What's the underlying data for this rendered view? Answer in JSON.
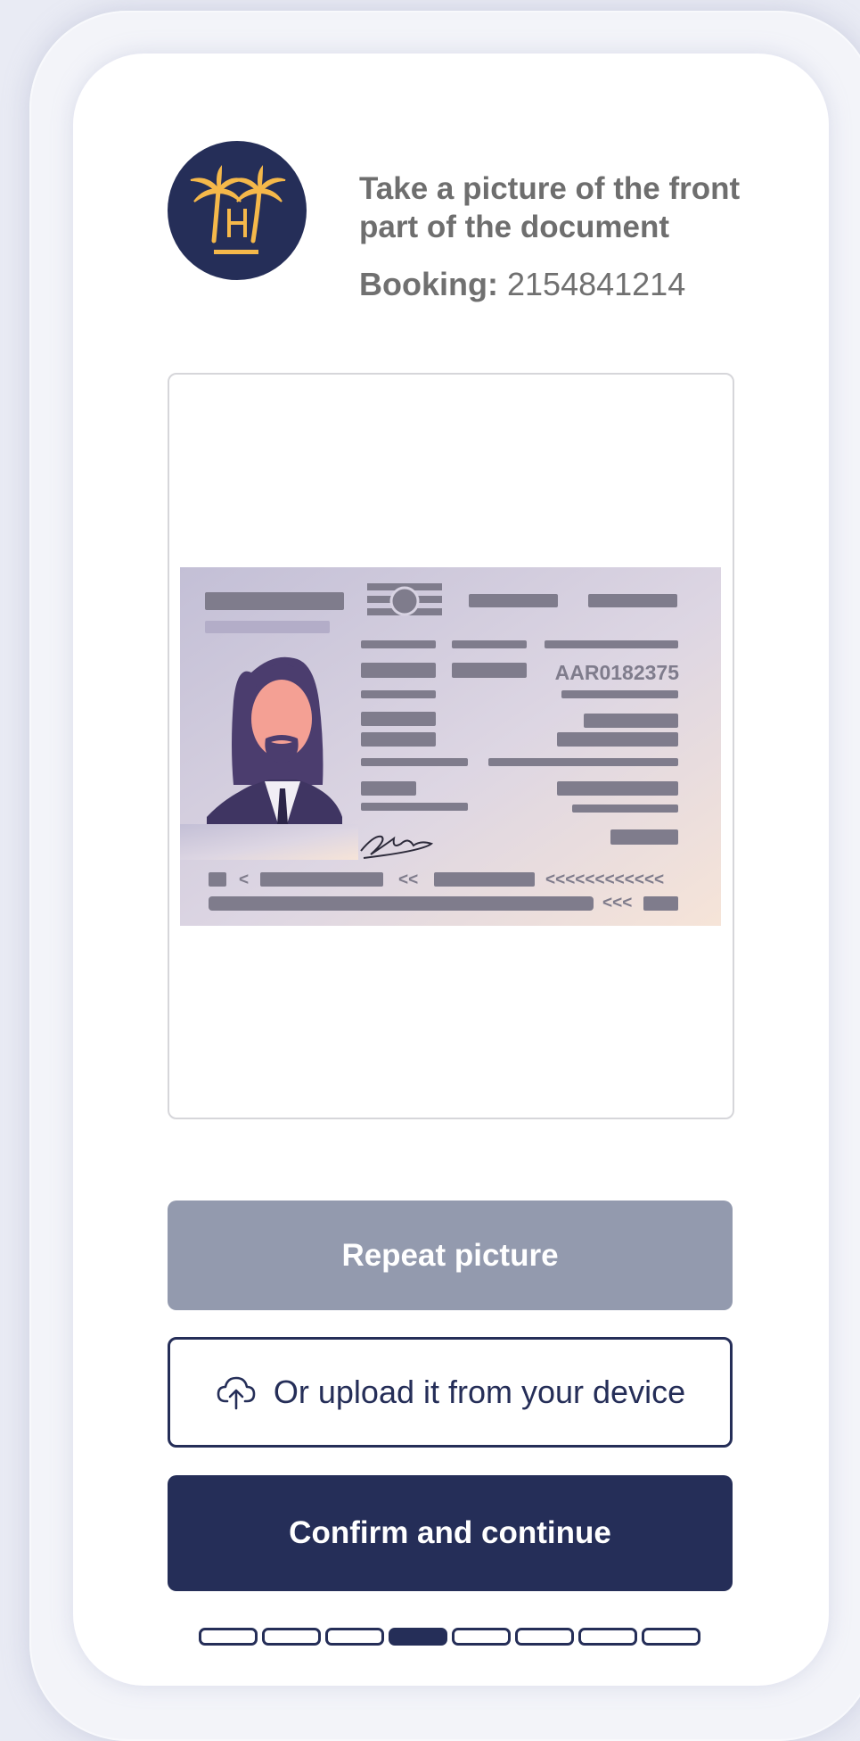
{
  "header": {
    "title": "Take a picture of the front part of the document",
    "booking_label": "Booking:",
    "booking_number": "2154841214",
    "logo_icon": "palm-trees-hotel-logo-icon"
  },
  "document": {
    "id_number": "AAR0182375",
    "mrz_line1_chevrons_a": "<",
    "mrz_line1_chevrons_b": "<<",
    "mrz_line1_chevrons_c": "<<<<<<<<<<<<",
    "mrz_line2_chevrons": "<<<"
  },
  "actions": {
    "repeat_label": "Repeat picture",
    "upload_label": "Or upload it from your device",
    "upload_icon": "cloud-upload-icon",
    "confirm_label": "Confirm and continue"
  },
  "progress": {
    "total_steps": 8,
    "current_step": 4
  },
  "colors": {
    "brand_navy": "#252e58",
    "logo_gold": "#f5b84a",
    "disabled_grey": "#939aae"
  }
}
